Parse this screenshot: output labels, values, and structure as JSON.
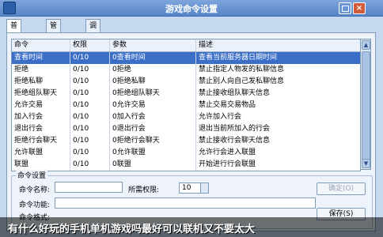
{
  "window": {
    "title": "游戏命令设置"
  },
  "tabs": [
    {
      "label": "普通命令",
      "active": true
    },
    {
      "label": "管理命令",
      "active": false
    },
    {
      "label": "调试命令",
      "active": false
    }
  ],
  "table": {
    "columns": [
      "命令",
      "权限",
      "参数",
      "描述"
    ],
    "rows": [
      [
        "查看时间",
        "0/10",
        "0查看时间",
        "查看当前服务器日期时间"
      ],
      [
        "拒绝",
        "0/10",
        "0拒绝",
        "禁止指定人物发的私聊信息"
      ],
      [
        "拒绝私聊",
        "0/10",
        "0拒绝私聊",
        "禁止别人向自己发私聊信息"
      ],
      [
        "拒绝组队聊天",
        "0/10",
        "0拒绝组队聊天",
        "禁止接收组队聊天信息"
      ],
      [
        "允许交易",
        "0/10",
        "0允许交易",
        "禁止交易交易物品"
      ],
      [
        "加入行会",
        "0/10",
        "0加入行会",
        "允许加入行会"
      ],
      [
        "退出行会",
        "0/10",
        "0退出行会",
        "退出当前所加入的行会"
      ],
      [
        "拒绝行会聊天",
        "0/10",
        "0拒绝行会聊天",
        "禁止接收行会聊天信息"
      ],
      [
        "允许联盟",
        "0/10",
        "0允许联盟",
        "允许行会进入联盟"
      ],
      [
        "联盟",
        "0/10",
        "0联盟",
        "开始进行行会联盟"
      ]
    ]
  },
  "settings": {
    "legend": "命令设置",
    "name_label": "命令名称:",
    "required_level_label": "所需权限:",
    "required_level_value": "10",
    "function_label": "命令功能:",
    "format_label": "命令格式:",
    "confirm_label": "确定(O)",
    "save_label": "保存(S)"
  },
  "caption": {
    "text": "有什么好玩的手机单机游戏吗最好可以联机又不要太大"
  }
}
